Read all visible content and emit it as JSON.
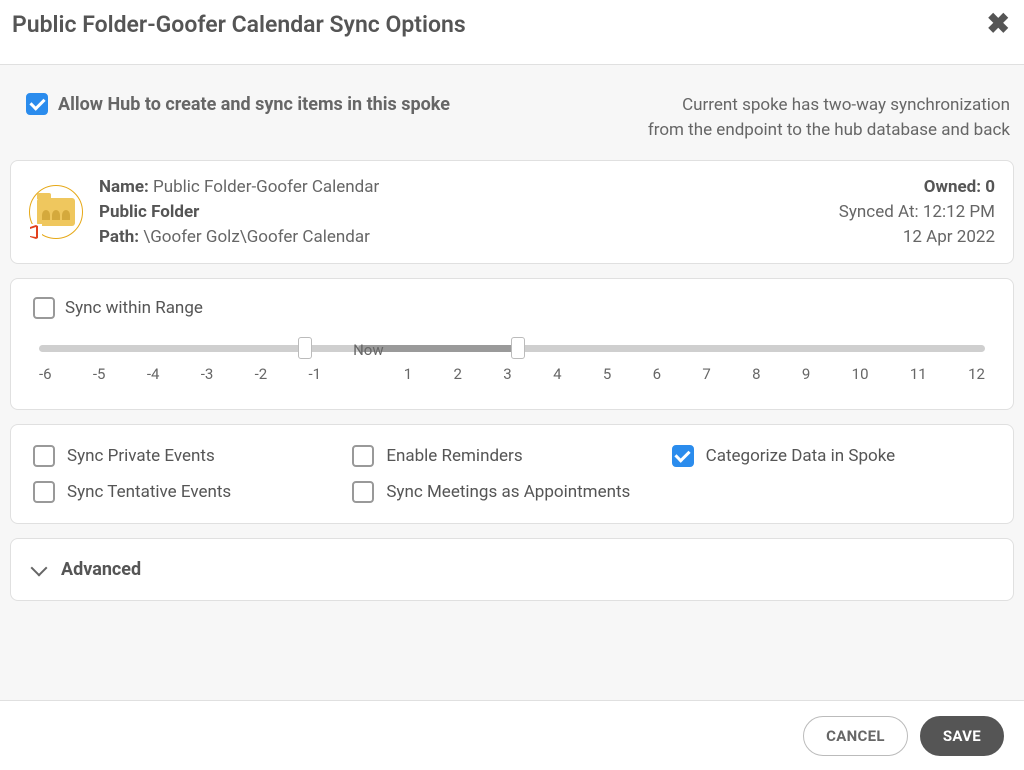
{
  "header": {
    "title": "Public Folder-Goofer Calendar Sync Options"
  },
  "allow": {
    "label": "Allow Hub to create and sync items in this spoke",
    "checked": true,
    "desc_line1": "Current spoke has two-way synchronization",
    "desc_line2": "from the endpoint to the hub database and back"
  },
  "info": {
    "name_label": "Name:",
    "name_value": "Public Folder-Goofer Calendar",
    "type_value": "Public Folder",
    "path_label": "Path:",
    "path_value": "\\Goofer Golz\\Goofer Calendar",
    "owned_label": "Owned:",
    "owned_value": "0",
    "synced_label": "Synced At:",
    "synced_time": "12:12 PM",
    "synced_date": "12 Apr 2022"
  },
  "range": {
    "label": "Sync within Range",
    "checked": false,
    "now_label": "Now",
    "ticks": [
      "-6",
      "-5",
      "-4",
      "-3",
      "-2",
      "-1",
      "",
      "1",
      "2",
      "3",
      "4",
      "5",
      "6",
      "7",
      "8",
      "9",
      "10",
      "11",
      "12"
    ],
    "min": -6,
    "max": 12,
    "handle1": -1,
    "handle2": 3,
    "now_pos": 0
  },
  "options": [
    {
      "label": "Sync Private Events",
      "checked": false
    },
    {
      "label": "Enable Reminders",
      "checked": false
    },
    {
      "label": "Categorize Data in Spoke",
      "checked": true
    },
    {
      "label": "Sync Tentative Events",
      "checked": false
    },
    {
      "label": "Sync Meetings as Appointments",
      "checked": false
    }
  ],
  "advanced": {
    "label": "Advanced"
  },
  "footer": {
    "cancel": "CANCEL",
    "save": "SAVE"
  }
}
